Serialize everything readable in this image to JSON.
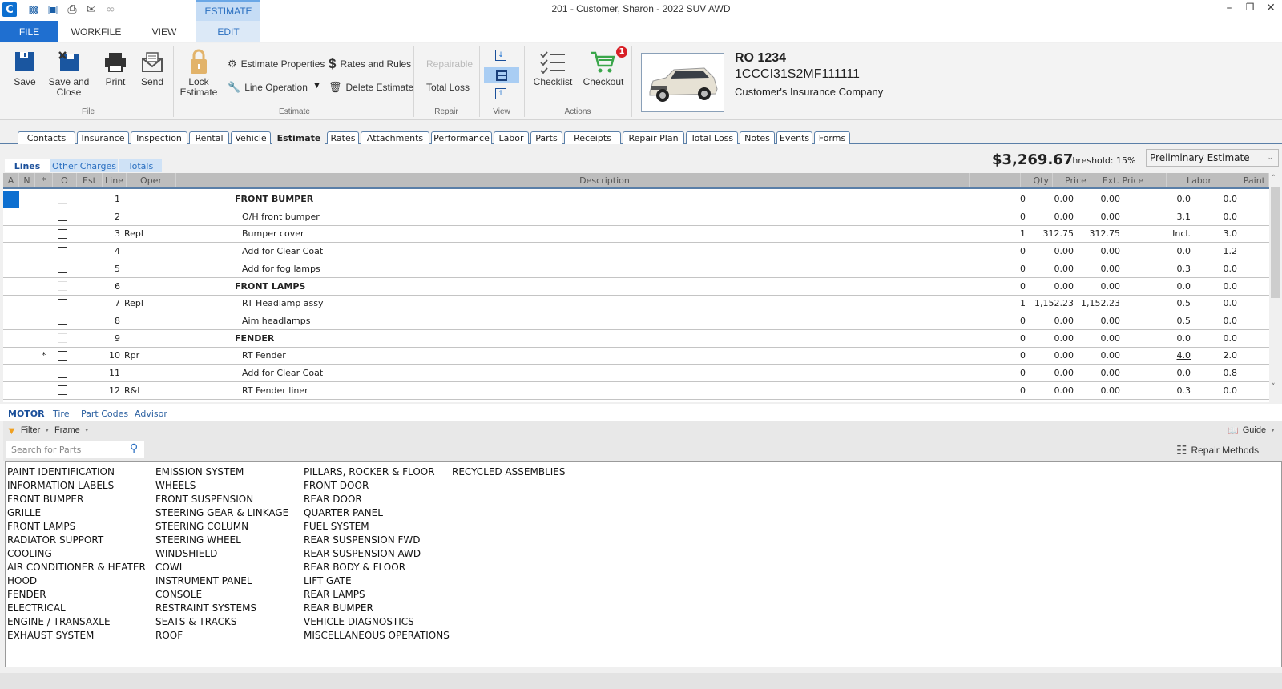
{
  "window": {
    "title": "201 - Customer, Sharon - 2022 SUV AWD",
    "minimize": "–",
    "restore": "❐",
    "close": "✕"
  },
  "quick_access": [
    "save-icon",
    "save-close-icon",
    "print-icon",
    "send-icon",
    "link-icon"
  ],
  "menu": {
    "file": "FILE",
    "workfile": "WORKFILE",
    "view": "VIEW",
    "context_header": "ESTIMATE",
    "edit": "EDIT"
  },
  "ribbon": {
    "file_group": {
      "label": "File",
      "save": "Save",
      "save_close_1": "Save and",
      "save_close_2": "Close",
      "print": "Print",
      "send": "Send"
    },
    "estimate_group": {
      "label": "Estimate",
      "lock_1": "Lock",
      "lock_2": "Estimate",
      "properties": "Estimate Properties",
      "line_operation": "Line Operation",
      "rates_rules": "Rates and Rules",
      "delete": "Delete Estimate"
    },
    "repair_group": {
      "label": "Repair",
      "repairable": "Repairable",
      "total_loss": "Total Loss"
    },
    "view_group": {
      "label": "View"
    },
    "actions_group": {
      "label": "Actions",
      "checklist": "Checklist",
      "checkout": "Checkout",
      "checkout_badge": "1"
    },
    "vehicle": {
      "ro": "RO 1234",
      "vin": "1CCCI31S2MF111111",
      "insurance": "Customer's Insurance Company"
    }
  },
  "tabs": [
    "Contacts",
    "Insurance",
    "Inspection",
    "Rental",
    "Vehicle",
    "Estimate",
    "Rates",
    "Attachments",
    "Performance",
    "Labor",
    "Parts",
    "Receipts",
    "Repair Plan",
    "Total Loss",
    "Notes",
    "Events",
    "Forms"
  ],
  "active_tab": "Estimate",
  "subtabs": [
    "Lines",
    "Other Charges",
    "Totals"
  ],
  "summary": {
    "total": "$3,269.67",
    "threshold": "threshold: 15%",
    "status": "Preliminary Estimate"
  },
  "grid": {
    "headers": {
      "a": "A",
      "n": "N",
      "star": "*",
      "o": "O",
      "est": "Est",
      "line": "Line",
      "oper": "Oper",
      "description": "Description",
      "qty": "Qty",
      "price": "Price",
      "ext_price": "Ext. Price",
      "labor": "Labor",
      "paint": "Paint"
    },
    "rows": [
      {
        "star": "",
        "line": "1",
        "oper": "",
        "desc": "FRONT BUMPER",
        "header": true,
        "qty": "0",
        "price": "0.00",
        "ext": "0.00",
        "labor": "0.0",
        "paint": "0.0"
      },
      {
        "star": "",
        "line": "2",
        "oper": "",
        "desc": "O/H front bumper",
        "header": false,
        "qty": "0",
        "price": "0.00",
        "ext": "0.00",
        "labor": "3.1",
        "paint": "0.0"
      },
      {
        "star": "",
        "line": "3",
        "oper": "Repl",
        "desc": "Bumper cover",
        "header": false,
        "qty": "1",
        "price": "312.75",
        "ext": "312.75",
        "labor": "Incl.",
        "paint": "3.0"
      },
      {
        "star": "",
        "line": "4",
        "oper": "",
        "desc": "Add for Clear Coat",
        "header": false,
        "qty": "0",
        "price": "0.00",
        "ext": "0.00",
        "labor": "0.0",
        "paint": "1.2"
      },
      {
        "star": "",
        "line": "5",
        "oper": "",
        "desc": "Add for fog lamps",
        "header": false,
        "qty": "0",
        "price": "0.00",
        "ext": "0.00",
        "labor": "0.3",
        "paint": "0.0"
      },
      {
        "star": "",
        "line": "6",
        "oper": "",
        "desc": "FRONT LAMPS",
        "header": true,
        "qty": "0",
        "price": "0.00",
        "ext": "0.00",
        "labor": "0.0",
        "paint": "0.0"
      },
      {
        "star": "",
        "line": "7",
        "oper": "Repl",
        "desc": "RT Headlamp assy",
        "header": false,
        "qty": "1",
        "price": "1,152.23",
        "ext": "1,152.23",
        "labor": "0.5",
        "paint": "0.0"
      },
      {
        "star": "",
        "line": "8",
        "oper": "",
        "desc": "Aim headlamps",
        "header": false,
        "qty": "0",
        "price": "0.00",
        "ext": "0.00",
        "labor": "0.5",
        "paint": "0.0"
      },
      {
        "star": "",
        "line": "9",
        "oper": "",
        "desc": "FENDER",
        "header": true,
        "qty": "0",
        "price": "0.00",
        "ext": "0.00",
        "labor": "0.0",
        "paint": "0.0"
      },
      {
        "star": "*",
        "line": "10",
        "oper": "Rpr",
        "desc": "RT Fender",
        "header": false,
        "qty": "0",
        "price": "0.00",
        "ext": "0.00",
        "labor": "4.0",
        "labor_underlined": true,
        "paint": "2.0"
      },
      {
        "star": "",
        "line": "11",
        "oper": "",
        "desc": "Add for Clear Coat",
        "header": false,
        "qty": "0",
        "price": "0.00",
        "ext": "0.00",
        "labor": "0.0",
        "paint": "0.8"
      },
      {
        "star": "",
        "line": "12",
        "oper": "R&I",
        "desc": "RT Fender liner",
        "header": false,
        "qty": "0",
        "price": "0.00",
        "ext": "0.00",
        "labor": "0.3",
        "paint": "0.0"
      }
    ]
  },
  "bottom_tabs": [
    "MOTOR",
    "Tire",
    "Part Codes",
    "Advisor"
  ],
  "bottom_toolbar": {
    "filter": "Filter",
    "frame": "Frame",
    "guide": "Guide",
    "repair_methods": "Repair Methods"
  },
  "search": {
    "placeholder": "Search for Parts"
  },
  "parts_columns": [
    [
      "PAINT IDENTIFICATION",
      "INFORMATION LABELS",
      "FRONT BUMPER",
      "GRILLE",
      "FRONT LAMPS",
      "RADIATOR SUPPORT",
      "COOLING",
      "AIR CONDITIONER & HEATER",
      "HOOD",
      "FENDER",
      "ELECTRICAL",
      "ENGINE / TRANSAXLE",
      "EXHAUST SYSTEM"
    ],
    [
      "EMISSION SYSTEM",
      "WHEELS",
      "FRONT SUSPENSION",
      "STEERING GEAR & LINKAGE",
      "STEERING COLUMN",
      "STEERING WHEEL",
      "WINDSHIELD",
      "COWL",
      "INSTRUMENT PANEL",
      "CONSOLE",
      "RESTRAINT SYSTEMS",
      "SEATS & TRACKS",
      "ROOF"
    ],
    [
      "PILLARS, ROCKER & FLOOR",
      "FRONT DOOR",
      "REAR DOOR",
      "QUARTER PANEL",
      "FUEL SYSTEM",
      "REAR SUSPENSION FWD",
      "REAR SUSPENSION AWD",
      "REAR BODY & FLOOR",
      "LIFT GATE",
      "REAR LAMPS",
      "REAR BUMPER",
      "VEHICLE DIAGNOSTICS",
      "MISCELLANEOUS OPERATIONS"
    ],
    [
      "RECYCLED ASSEMBLIES"
    ]
  ]
}
